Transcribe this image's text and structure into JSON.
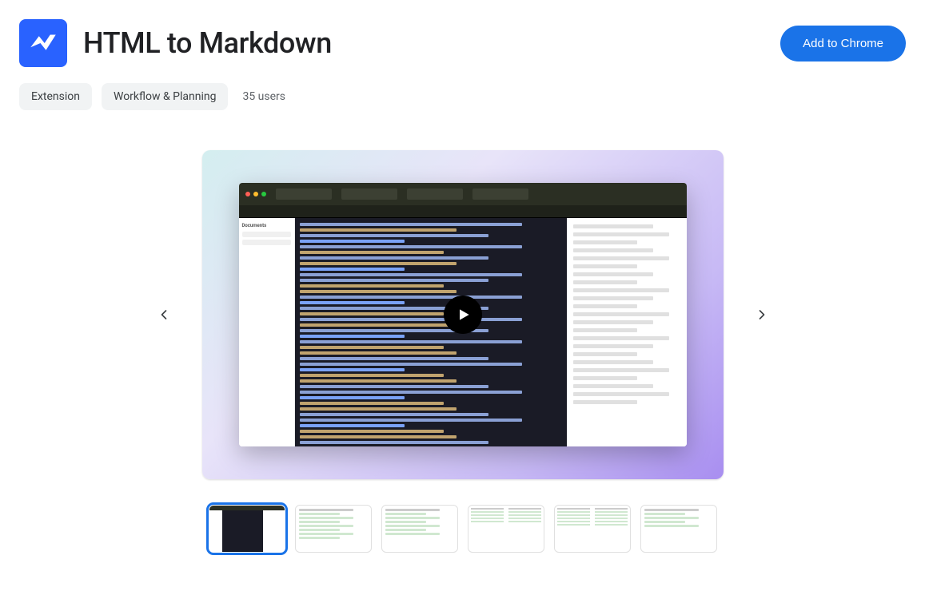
{
  "header": {
    "title": "HTML to Markdown",
    "add_button": "Add to Chrome"
  },
  "meta": {
    "chips": [
      "Extension",
      "Workflow & Planning"
    ],
    "users": "35 users"
  },
  "carousel": {
    "prev_label": "Previous",
    "next_label": "Next",
    "play_label": "Play video",
    "thumbnails_count": 6,
    "selected_index": 0
  }
}
